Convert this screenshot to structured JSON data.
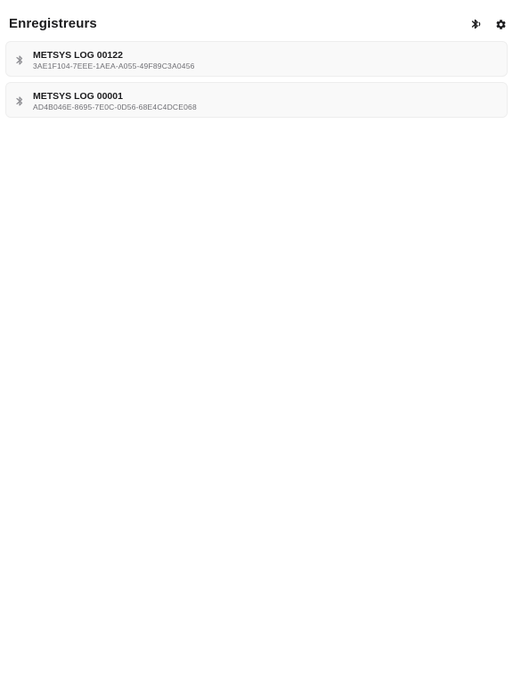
{
  "header": {
    "title": "Enregistreurs",
    "scan_icon": "bluetooth-scan-icon",
    "settings_icon": "gear-icon"
  },
  "devices": [
    {
      "name": "METSYS LOG 00122",
      "uuid": "3AE1F104-7EEE-1AEA-A055-49F89C3A0456",
      "icon": "bluetooth-icon"
    },
    {
      "name": "METSYS LOG 00001",
      "uuid": "AD4B046E-8695-7E0C-0D56-68E4C4DCE068",
      "icon": "bluetooth-icon"
    }
  ],
  "colors": {
    "text_primary": "#1c1c1e",
    "text_secondary": "#6e6e73",
    "card_background": "#f9f9f9",
    "card_border": "#eeeeee",
    "icon_muted": "#8e8e93"
  }
}
